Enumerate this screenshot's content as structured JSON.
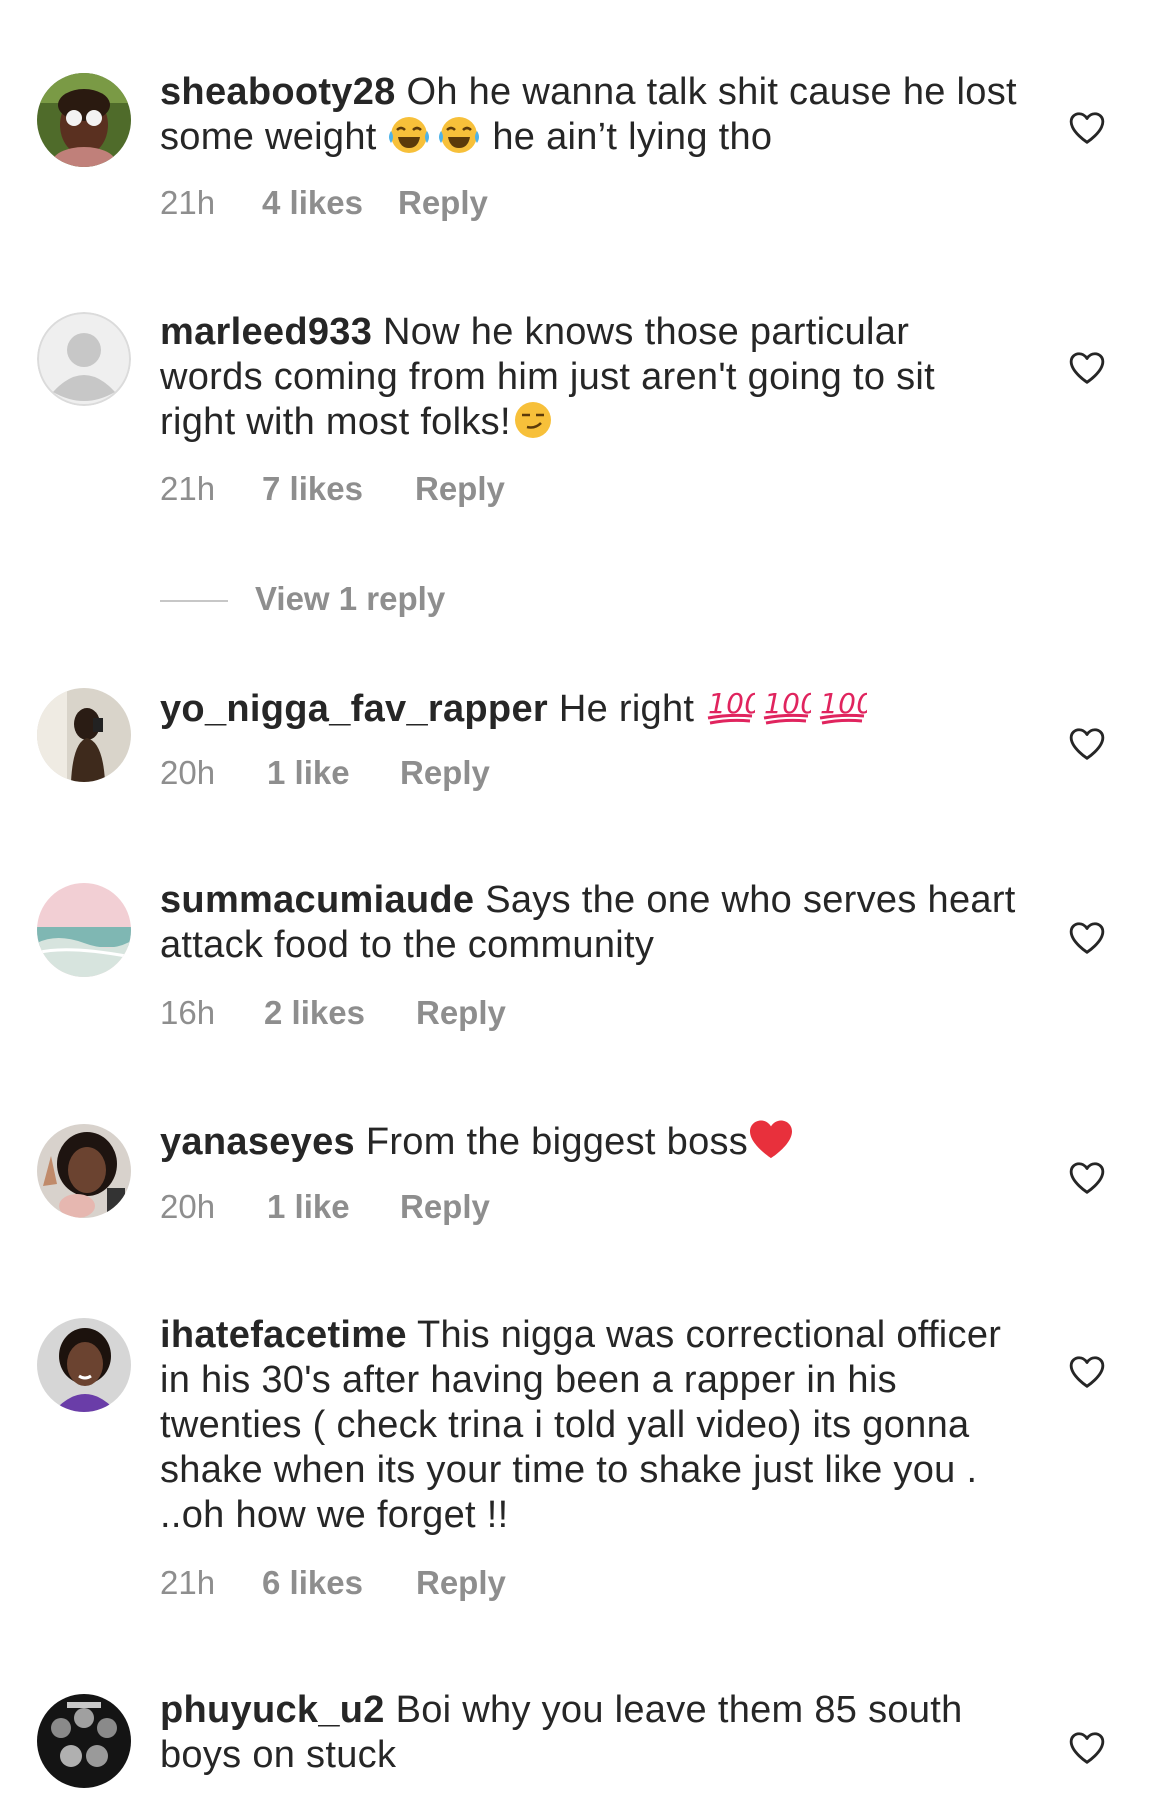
{
  "comments": [
    {
      "username": "sheabooty28",
      "text_parts": [
        "Oh he wanna talk shit cause he lost some weight ",
        " he ain’t lying tho"
      ],
      "emoji": "face-with-tears-of-joy x2",
      "time": "21h",
      "likes": "4 likes",
      "reply": "Reply"
    },
    {
      "username": "marleed933",
      "text_parts": [
        "Now he knows those particular words coming from him  just aren't going to sit right with most folks!"
      ],
      "emoji": "smirking-face",
      "time": "21h",
      "likes": "7 likes",
      "reply": "Reply",
      "view_replies": "View 1 reply"
    },
    {
      "username": "yo_nigga_fav_rapper",
      "text_parts": [
        "He right "
      ],
      "emoji": "hundred-points x3",
      "time": "20h",
      "likes": "1 like",
      "reply": "Reply"
    },
    {
      "username": "summacumiaude",
      "text_parts": [
        "Says the one who serves heart attack food to the community"
      ],
      "time": "16h",
      "likes": "2 likes",
      "reply": "Reply"
    },
    {
      "username": "yanaseyes",
      "text_parts": [
        "From the biggest boss"
      ],
      "emoji": "red-heart",
      "time": "20h",
      "likes": "1 like",
      "reply": "Reply"
    },
    {
      "username": "ihatefacetime",
      "text_parts": [
        "This nigga was correctional officer in his 30's after having been a rapper in his twenties ( check trina i told yall video) its gonna shake when its your time to shake just like you . ..oh how we forget !!"
      ],
      "time": "21h",
      "likes": "6 likes",
      "reply": "Reply"
    },
    {
      "username": "phuyuck_u2",
      "text_parts": [
        "Boi why you leave them 85 south boys on stuck"
      ]
    }
  ],
  "colors": {
    "text": "#262626",
    "secondary": "#8e8e8e",
    "background": "#ffffff"
  },
  "icons": {
    "like": "heart-outline-icon"
  }
}
